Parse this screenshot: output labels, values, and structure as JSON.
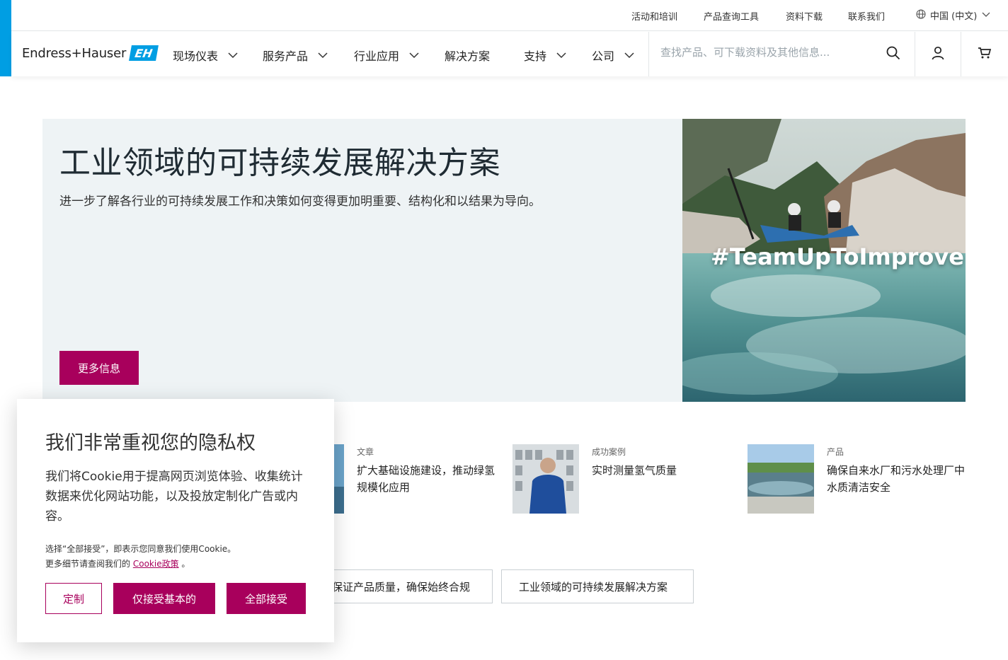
{
  "util_nav": {
    "events": "活动和培训",
    "product_tools": "产品查询工具",
    "downloads": "资料下载",
    "contact": "联系我们",
    "language": "中国 (中文)"
  },
  "brand": {
    "name": "Endress+Hauser",
    "mark": "EH",
    "accent_color": "#009ee3",
    "cta_color": "#a8005c"
  },
  "main_nav": {
    "items": [
      {
        "label": "现场仪表",
        "has_dropdown": true
      },
      {
        "label": "服务产品",
        "has_dropdown": true
      },
      {
        "label": "行业应用",
        "has_dropdown": true
      },
      {
        "label": "解决方案",
        "has_dropdown": false
      },
      {
        "label": "支持",
        "has_dropdown": true
      },
      {
        "label": "公司",
        "has_dropdown": true
      }
    ],
    "search_placeholder": "查找产品、可下载资料及其他信息..."
  },
  "hero": {
    "title": "工业领域的可持续发展解决方案",
    "subtitle": "进一步了解各行业的可持续发展工作和决策如何变得更加明重要、结构化和以结果为导向。",
    "button": "更多信息",
    "image_overlay_text": "#TeamUpToImprove"
  },
  "cards": [
    {
      "category": "文章",
      "title": "扩大基础设施建设，推动绿氢规模化应用"
    },
    {
      "category": "成功案例",
      "title": "实时测量氢气质量"
    },
    {
      "category": "产品",
      "title": "确保自来水厂和污水处理厂中水质清洁安全"
    }
  ],
  "tags": [
    "保证产品质量，确保始终合规",
    "工业领域的可持续发展解决方案"
  ],
  "cookie": {
    "title": "我们非常重视您的隐私权",
    "body": "我们将Cookie用于提高网页浏览体验、收集统计数据来优化网站功能，以及投放定制化广告或内容。",
    "note_line1": "选择“全部接受”，即表示您同意我们使用Cookie。",
    "note_line2_prefix": "更多细节请查阅我们的",
    "note_link": "Cookie政策",
    "note_line2_suffix": "。",
    "btn_customize": "定制",
    "btn_essential": "仅接受基本的",
    "btn_accept_all": "全部接受"
  }
}
